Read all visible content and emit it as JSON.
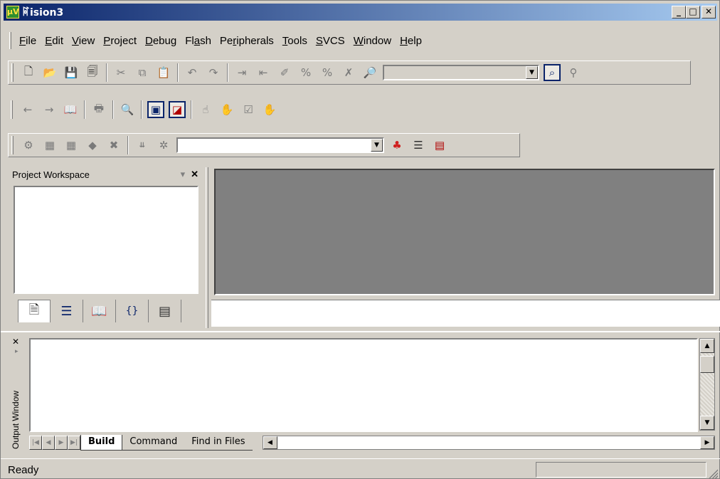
{
  "window": {
    "title": "ꌸision3",
    "icon_text": "μV",
    "caption_buttons": [
      "_",
      "□",
      "✕"
    ]
  },
  "menu": {
    "items": [
      {
        "label": "File",
        "accel": "F",
        "rest": "ile"
      },
      {
        "label": "Edit",
        "accel": "E",
        "rest": "dit"
      },
      {
        "label": "View",
        "accel": "V",
        "rest": "iew"
      },
      {
        "label": "Project",
        "accel": "P",
        "rest": "roject"
      },
      {
        "label": "Debug",
        "accel": "D",
        "rest": "ebug"
      },
      {
        "label": "Flash",
        "pre": "Fl",
        "accel": "a",
        "rest": "sh"
      },
      {
        "label": "Peripherals",
        "pre": "Pe",
        "accel": "r",
        "rest": "ipherals"
      },
      {
        "label": "Tools",
        "accel": "T",
        "rest": "ools"
      },
      {
        "label": "SVCS",
        "accel": "S",
        "rest": "VCS"
      },
      {
        "label": "Window",
        "accel": "W",
        "rest": "indow"
      },
      {
        "label": "Help",
        "accel": "H",
        "rest": "elp"
      }
    ]
  },
  "toolbar_combo": {
    "value": ""
  },
  "target_combo": {
    "value": ""
  },
  "workspace": {
    "title": "Project Workspace",
    "pin_glyph": "▾",
    "close_glyph": "✕"
  },
  "output": {
    "title": "Output Window",
    "close_glyph": "✕",
    "tabs": [
      "Build",
      "Command",
      "Find in Files"
    ],
    "active_tab": "Build"
  },
  "status": {
    "text": "Ready"
  },
  "colors": {
    "title_start": "#0a246a",
    "title_end": "#a6caf0",
    "face": "#d4d0c8",
    "mdi_bg": "#808080"
  }
}
